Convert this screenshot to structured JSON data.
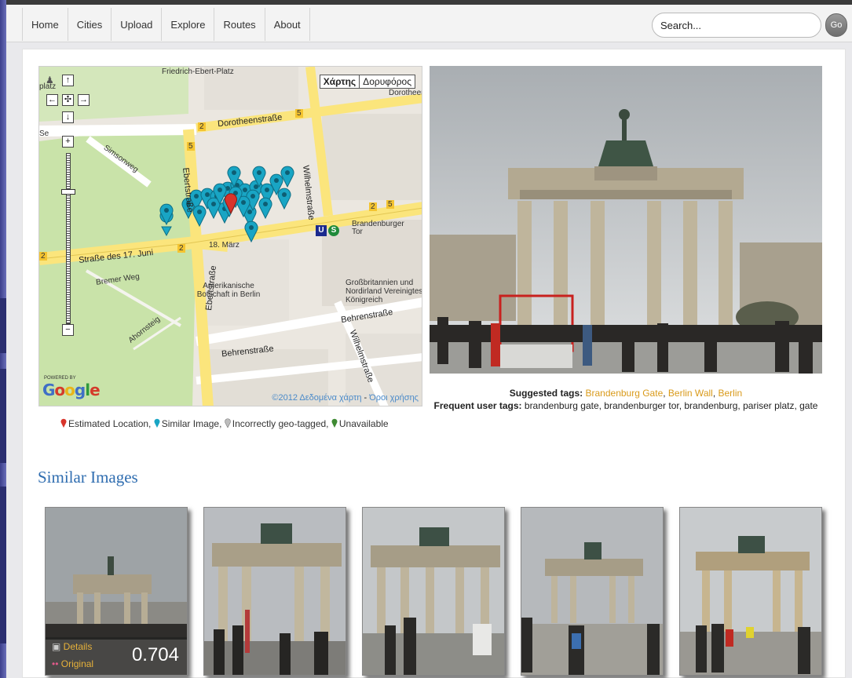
{
  "nav": {
    "items": [
      "Home",
      "Cities",
      "Upload",
      "Explore",
      "Routes",
      "About"
    ],
    "search_placeholder": "Search...",
    "go_label": "Go"
  },
  "map": {
    "type_options": [
      "Χάρτης",
      "Δορυφόρος"
    ],
    "selected_type": "Χάρτης",
    "labels": {
      "top_place": "Friedrich-Ebert-Platz",
      "dorotheen": "Dorotheenstraße",
      "dorotheen_right": "Dorotheen",
      "wilhelm": "Wilhelmstraße",
      "wilhelm2": "Wilhelmstraße",
      "simson": "Simsonweg",
      "strasse17": "Straße des 17. Juni",
      "bremer": "Bremer Weg",
      "ahorn": "Ahornsteig",
      "ebert": "Ebertstraße",
      "ebert_top": "Ebertstraße",
      "behren": "Behrenstraße",
      "behren2": "Behrenstraße",
      "maerz": "18. März",
      "embassy": "Amerikanische Botschaft in Berlin",
      "uk": "Großbritannien und Nordirland Vereinigtes Königreich",
      "brandenburger": "Brandenburger Tor",
      "platz_left": "platz",
      "se": "Se"
    },
    "road_numbers": [
      "2",
      "5",
      "5",
      "2",
      "5",
      "2",
      "2"
    ],
    "powered_by": "POWERED BY",
    "google": "Google",
    "copyright": "©2012 Δεδομένα χάρτη",
    "terms": "Όροι χρήσης"
  },
  "legend": {
    "estimated": "Estimated Location,",
    "similar": "Similar Image,",
    "incorrect": "Incorrectly geo-tagged,",
    "unavailable": "Unavailable",
    "colors": {
      "estimated": "#d8342b",
      "similar": "#19a5c4",
      "incorrect": "#bdbdbd",
      "unavailable": "#3f8a33"
    }
  },
  "tags": {
    "suggested_label": "Suggested tags:",
    "suggested": [
      "Brandenburg Gate",
      "Berlin Wall",
      "Berlin"
    ],
    "frequent_label": "Frequent user tags:",
    "frequent": "brandenburg gate, brandenburger tor, brandenburg, pariser platz, gate"
  },
  "similar": {
    "title": "Similar Images",
    "first": {
      "details": "Details",
      "original": "Original",
      "score": "0.704"
    }
  }
}
